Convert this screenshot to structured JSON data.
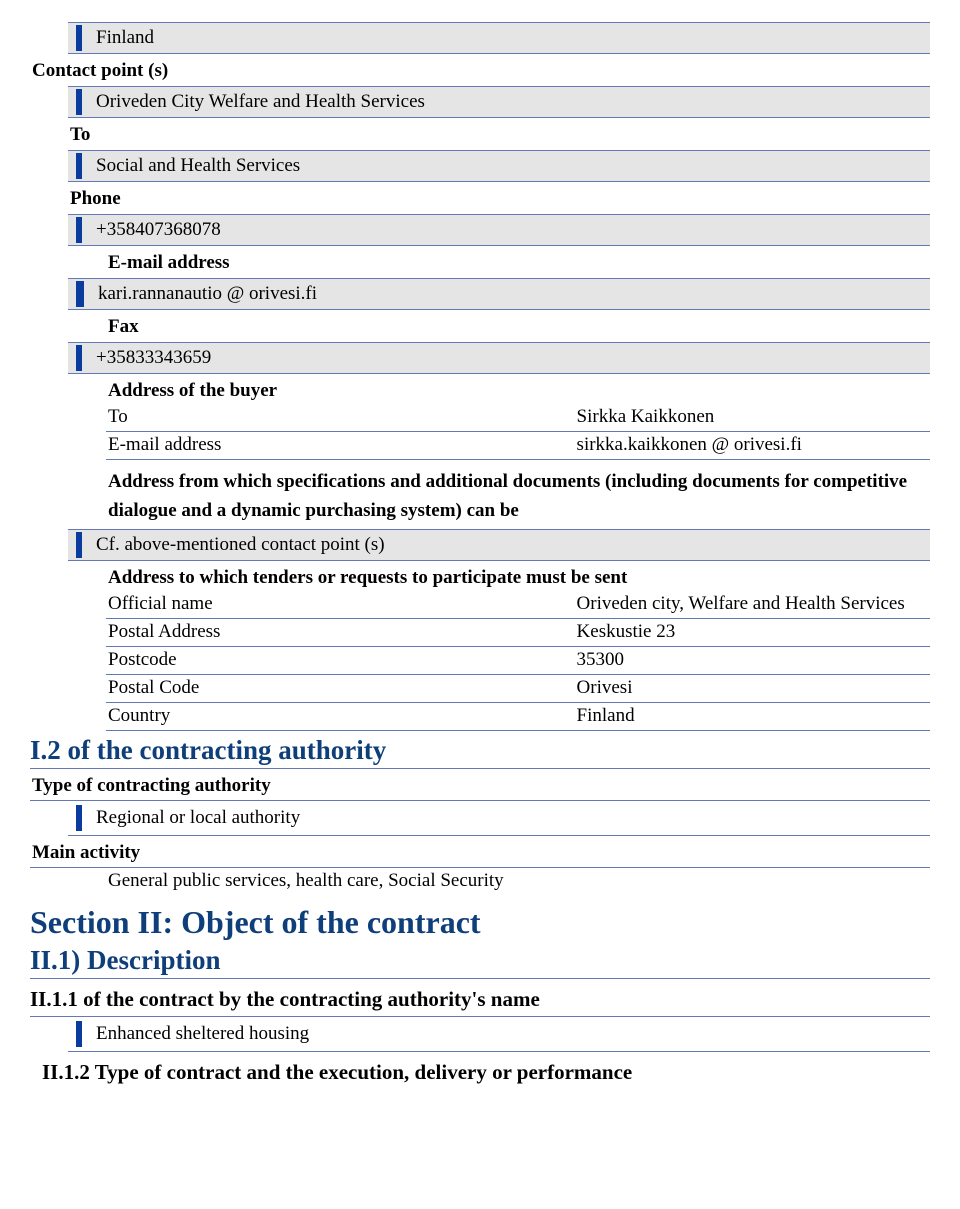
{
  "country": "Finland",
  "contactLabel": "Contact point (s)",
  "contactValue": "Oriveden City Welfare and Health Services",
  "toLabel": "To",
  "toValue": "Social and Health Services",
  "phoneLabel": "Phone",
  "phoneValue": "+358407368078",
  "emailLabel": "E-mail address",
  "emailValue": "kari.rannanautio @ orivesi.fi",
  "faxLabel": "Fax",
  "faxValue": "+35833343659",
  "buyerAddressLabel": "Address of the buyer",
  "buyerToLabel": "To",
  "buyerToValue": "Sirkka Kaikkonen",
  "buyerEmailLabel": "E-mail address",
  "buyerEmailValue": "sirkka.kaikkonen @ orivesi.fi",
  "specHeading": "Address from which specifications and additional documents (including documents for competitive dialogue and a dynamic purchasing system) can be",
  "specValue": "Cf. above-mentioned contact point (s)",
  "sendHeading": "Address to which tenders or requests to participate must be sent",
  "officialNameLabel": "Official name",
  "officialNameValue": "Oriveden city, Welfare and Health Services",
  "postalAddressLabel": "Postal Address",
  "postalAddressValue": "Keskustie 23",
  "postcodeLabel": "Postcode",
  "postcodeValue": "35300",
  "postalCodeLabel": "Postal Code",
  "postalCodeValue": "Orivesi",
  "countryLabel": "Country",
  "countryValue": "Finland",
  "sectionI2": "I.2 of the contracting authority",
  "typeAuthorityLabel": "Type of contracting authority",
  "typeAuthorityValue": "Regional or local authority",
  "mainActivityLabel": "Main activity",
  "mainActivityValue": "General public services, health care, Social Security",
  "sectionII": "Section II: Object of the contract",
  "sectionII1": "II.1) Description",
  "sectionII11": "II.1.1 of the contract by the contracting authority's name",
  "sectionII11Value": "Enhanced sheltered housing",
  "sectionII12": "II.1.2 Type of contract and the execution, delivery or performance"
}
